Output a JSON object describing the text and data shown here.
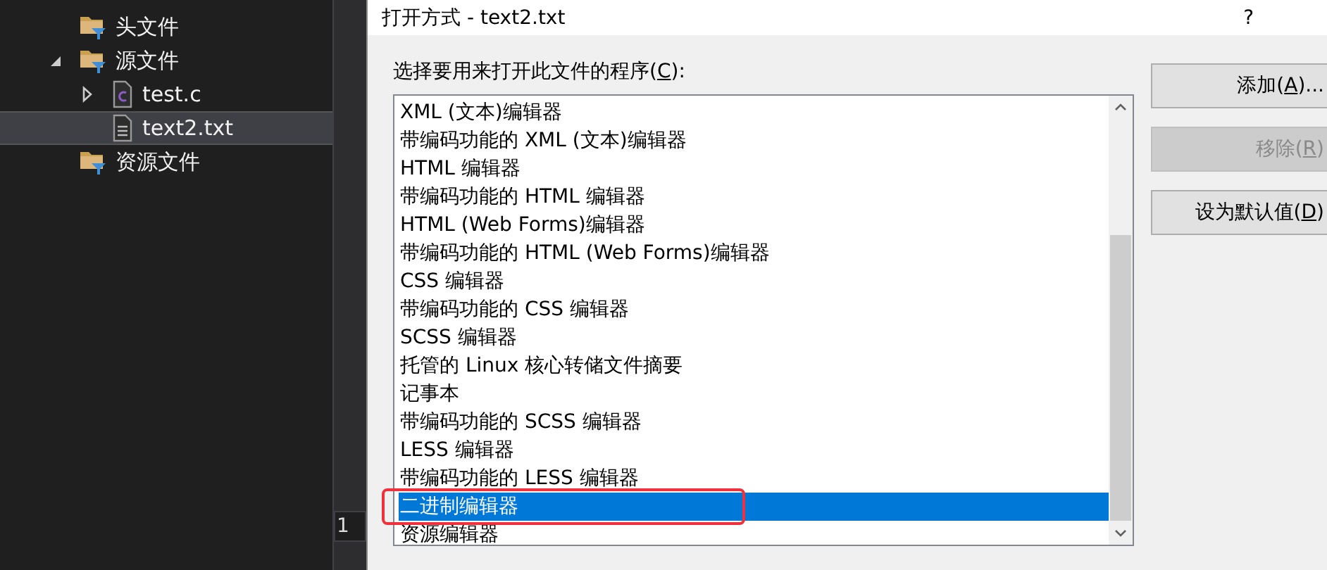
{
  "solution_tree": {
    "items": [
      {
        "label": "头文件",
        "kind": "folder",
        "selected": false
      },
      {
        "label": "源文件",
        "kind": "folder",
        "expanded": true,
        "selected": false,
        "children": [
          {
            "label": "test.c",
            "kind": "c-file",
            "expanded": false,
            "selected": false
          },
          {
            "label": "text2.txt",
            "kind": "text-file",
            "selected": true
          }
        ]
      },
      {
        "label": "资源文件",
        "kind": "folder",
        "selected": false
      }
    ]
  },
  "editor_line_number": "1",
  "dialog": {
    "title": "打开方式 - text2.txt",
    "help": "?",
    "prompt": "选择要用来打开此文件的程序(C):",
    "programs": [
      {
        "label": "XML (文本)编辑器",
        "selected": false
      },
      {
        "label": "带编码功能的 XML (文本)编辑器",
        "selected": false
      },
      {
        "label": "HTML 编辑器",
        "selected": false
      },
      {
        "label": "带编码功能的 HTML 编辑器",
        "selected": false
      },
      {
        "label": "HTML (Web Forms)编辑器",
        "selected": false
      },
      {
        "label": "带编码功能的 HTML (Web Forms)编辑器",
        "selected": false
      },
      {
        "label": "CSS 编辑器",
        "selected": false
      },
      {
        "label": "带编码功能的 CSS 编辑器",
        "selected": false
      },
      {
        "label": "SCSS 编辑器",
        "selected": false
      },
      {
        "label": "托管的 Linux 核心转储文件摘要",
        "selected": false
      },
      {
        "label": "记事本",
        "selected": false
      },
      {
        "label": "带编码功能的 SCSS 编辑器",
        "selected": false
      },
      {
        "label": "LESS 编辑器",
        "selected": false
      },
      {
        "label": "带编码功能的 LESS 编辑器",
        "selected": false
      },
      {
        "label": "二进制编辑器",
        "selected": true,
        "highlighted": true
      },
      {
        "label": "资源编辑器",
        "selected": false
      }
    ],
    "buttons": [
      {
        "label": "添加(A)...",
        "disabled": false
      },
      {
        "label": "移除(R)",
        "disabled": true
      },
      {
        "label": "设为默认值(D)",
        "disabled": false
      }
    ]
  }
}
